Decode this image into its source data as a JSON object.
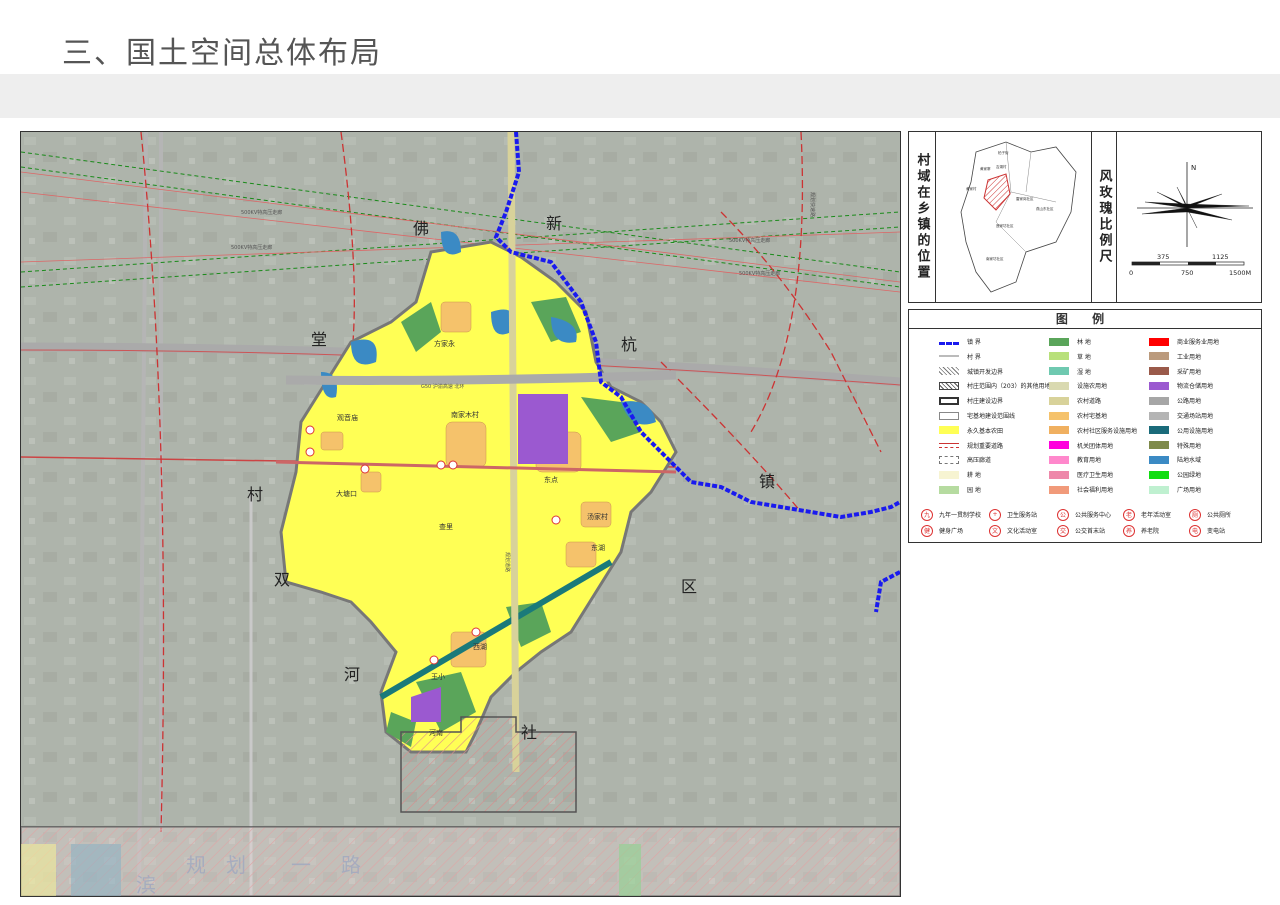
{
  "page": {
    "title": "三、国土空间总体布局"
  },
  "map": {
    "town_labels": [
      "佛",
      "新",
      "堂",
      "杭",
      "村",
      "镇",
      "双",
      "区",
      "河",
      "社"
    ],
    "village_labels": [
      "方家永",
      "观音庙",
      "南家木村",
      "大塘口",
      "查里",
      "东点",
      "汤家村",
      "东湖",
      "西湖",
      "王小",
      "河南"
    ],
    "powerline_labels": [
      "500KV特高压走廊",
      "500KV特高压走廊",
      "500KV特高压走廊",
      "500KV特高压走廊"
    ],
    "road_labels": [
      "G50 沪渝高速 北环",
      "规划道路"
    ],
    "bottom_road_chars": [
      "滨",
      "规",
      "划",
      "一",
      "路"
    ],
    "right_road_label": "规划快速路"
  },
  "locator": {
    "label": "村域在乡镇的位置",
    "place_labels": [
      "柏子街",
      "黄家寨",
      "吉湖村",
      "黄家村",
      "雷家岗社区",
      "燕山东社区",
      "莲家坊社区",
      "南家坊社区"
    ]
  },
  "rose": {
    "label": "风玫瑰比例尺",
    "north": "N",
    "scale_top": [
      "375",
      "1125"
    ],
    "scale_bottom": [
      "0",
      "750",
      "1500M"
    ]
  },
  "legend": {
    "title": "图 例",
    "items": [
      {
        "label": "镇 界",
        "type": "town-boundary"
      },
      {
        "label": "林 地",
        "color": "#5aa55a"
      },
      {
        "label": "商业服务业用地",
        "color": "#ff0000"
      },
      {
        "label": "村 界",
        "type": "village-boundary"
      },
      {
        "label": "草 地",
        "color": "#b8e07a"
      },
      {
        "label": "工业用地",
        "color": "#bb9a7c"
      },
      {
        "label": "城镇开发边界",
        "type": "hatch"
      },
      {
        "label": "湿 地",
        "color": "#6fc9b0"
      },
      {
        "label": "采矿用地",
        "color": "#9a5a4a"
      },
      {
        "label": "村庄范围内（203）的其他用地",
        "type": "cross-hatch"
      },
      {
        "label": "设施农用地",
        "color": "#d9d9b0"
      },
      {
        "label": "物流仓储用地",
        "color": "#9b59d0"
      },
      {
        "label": "村庄建设边界",
        "type": "outline-thick"
      },
      {
        "label": "农村道路",
        "color": "#d8d29a"
      },
      {
        "label": "公路用地",
        "color": "#a6a6a6"
      },
      {
        "label": "宅基地建设范围线",
        "type": "outline-thin"
      },
      {
        "label": "农村宅基地",
        "color": "#f5c26b"
      },
      {
        "label": "交通场站用地",
        "color": "#b4b4b4"
      },
      {
        "label": "永久基本农田",
        "color": "#ffff55"
      },
      {
        "label": "农村社区服务设施用地",
        "color": "#f0b060"
      },
      {
        "label": "公用设施用地",
        "color": "#1a6b7a"
      },
      {
        "label": "规划重要道路",
        "type": "road-red"
      },
      {
        "label": "机关团体用地",
        "color": "#ff00dd"
      },
      {
        "label": "特殊用地",
        "color": "#7e8a4a"
      },
      {
        "label": "高压廊道",
        "type": "dashed-green"
      },
      {
        "label": "教育用地",
        "color": "#ff88cc"
      },
      {
        "label": "陆地水域",
        "color": "#3b8ac4"
      },
      {
        "label": "耕 地",
        "color": "#f7f4d2"
      },
      {
        "label": "医疗卫生用地",
        "color": "#ee88aa"
      },
      {
        "label": "公园绿地",
        "color": "#11dd11"
      },
      {
        "label": "园 地",
        "color": "#b6dba0"
      },
      {
        "label": "社会福利用地",
        "color": "#f19a7a"
      },
      {
        "label": "广场用地",
        "color": "#bff0d0"
      }
    ],
    "symbols": [
      {
        "label": "九年一贯制学校",
        "glyph": "九"
      },
      {
        "label": "卫生服务站",
        "glyph": "+"
      },
      {
        "label": "公共服务中心",
        "glyph": "公"
      },
      {
        "label": "老年活动室",
        "glyph": "老"
      },
      {
        "label": "公共厕所",
        "glyph": "厕"
      },
      {
        "label": "健身广场",
        "glyph": "健"
      },
      {
        "label": "文化活动室",
        "glyph": "文"
      },
      {
        "label": "公交首末站",
        "glyph": "交"
      },
      {
        "label": "养老院",
        "glyph": "养"
      },
      {
        "label": "变电站",
        "glyph": "电"
      }
    ]
  }
}
